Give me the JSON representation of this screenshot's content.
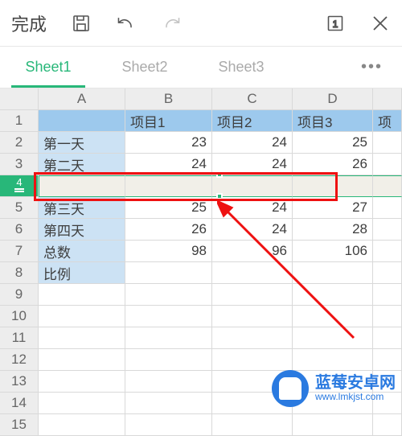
{
  "topbar": {
    "done_label": "完成"
  },
  "tabs": {
    "items": [
      "Sheet1",
      "Sheet2",
      "Sheet3"
    ],
    "active_index": 0,
    "more_glyph": "•••"
  },
  "watermark": {
    "name": "蓝莓安卓网",
    "url": "www.lmkjst.com"
  },
  "sheet": {
    "col_headers": [
      "A",
      "B",
      "C",
      "D"
    ],
    "row_indices": [
      1,
      2,
      3,
      4,
      5,
      6,
      7,
      8,
      9,
      10,
      11,
      12,
      13,
      14,
      15
    ],
    "selected_row": 4,
    "inserted_row": 4,
    "header_row": {
      "A": "",
      "B": "项目1",
      "C": "项目2",
      "D": "项目3",
      "E_partial": "项"
    },
    "data_rows": [
      {
        "A": "第一天",
        "B": 23,
        "C": 24,
        "D": 25
      },
      {
        "A": "第二天",
        "B": 24,
        "C": 24,
        "D": 26
      },
      {
        "A": "",
        "B": "",
        "C": "",
        "D": ""
      },
      {
        "A": "第三天",
        "B": 25,
        "C": 24,
        "D": 27
      },
      {
        "A": "第四天",
        "B": 26,
        "C": 24,
        "D": 28
      },
      {
        "A": "总数",
        "B": 98,
        "C": 96,
        "D": 106
      },
      {
        "A": "比例",
        "B": "",
        "C": "",
        "D": ""
      }
    ]
  },
  "chart_data": {
    "type": "table",
    "title": "",
    "columns": [
      "",
      "项目1",
      "项目2",
      "项目3"
    ],
    "rows": [
      [
        "第一天",
        23,
        24,
        25
      ],
      [
        "第二天",
        24,
        24,
        26
      ],
      [
        "第三天",
        25,
        24,
        27
      ],
      [
        "第四天",
        26,
        24,
        28
      ],
      [
        "总数",
        98,
        96,
        106
      ],
      [
        "比例",
        null,
        null,
        null
      ]
    ]
  }
}
